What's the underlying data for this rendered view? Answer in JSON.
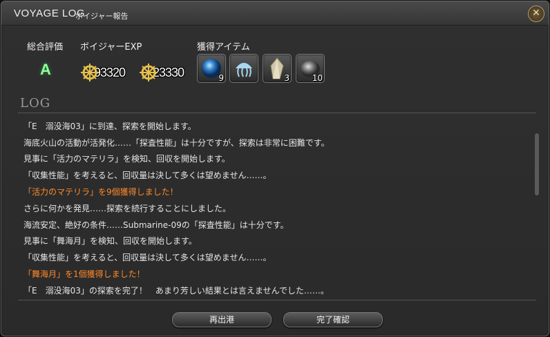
{
  "window": {
    "title": "VOYAGE LOG",
    "subtitle": "ボイジャー報告",
    "close_icon": "close-icon"
  },
  "summary": {
    "grade_label": "総合評価",
    "grade": "A",
    "exp_label": "ボイジャーEXP",
    "exp_values": [
      "93320",
      "23330"
    ],
    "items_label": "獲得アイテム",
    "items": [
      {
        "icon": "blue-orb-icon",
        "count": "9"
      },
      {
        "icon": "jellyfish-icon",
        "count": ""
      },
      {
        "icon": "crystal-icon",
        "count": "3"
      },
      {
        "icon": "ore-stone-icon",
        "count": "10"
      }
    ]
  },
  "log": {
    "title": "LOG",
    "lines": [
      {
        "text": "「E　溺没海03」に到達、探索を開始します。",
        "highlight": false
      },
      {
        "text": "海底火山の活動が活発化……「探査性能」は十分ですが、探索は非常に困難です。",
        "highlight": false
      },
      {
        "text": "見事に「活力のマテリラ」を検知、回収を開始します。",
        "highlight": false
      },
      {
        "text": "「収集性能」を考えると、回収量は決して多くは望めません……。",
        "highlight": false
      },
      {
        "text": "「活力のマテリラ」を9個獲得しました！",
        "highlight": true
      },
      {
        "text": "さらに何かを発見……探索を続行することにしました。",
        "highlight": false
      },
      {
        "text": "海流安定、絶好の条件……Submarine-09の「探査性能」は十分です。",
        "highlight": false
      },
      {
        "text": "見事に「舞海月」を検知、回収を開始します。",
        "highlight": false
      },
      {
        "text": "「収集性能」を考えると、回収量は決して多くは望めません……。",
        "highlight": false
      },
      {
        "text": "「舞海月」を1個獲得しました！",
        "highlight": true
      },
      {
        "text": "「E　溺没海03」の探索を完了！　あまり芳しい結果とは言えませんでした……。",
        "highlight": false
      }
    ]
  },
  "buttons": {
    "redeploy": "再出港",
    "finalize": "完了確認"
  },
  "colors": {
    "highlight": "#ff8a2a",
    "grade": "#8fff9c",
    "text": "#e6e6e6"
  }
}
